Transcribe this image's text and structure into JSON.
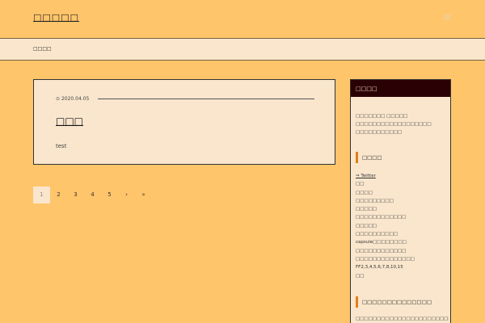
{
  "header": {
    "site_title": "□□□□□",
    "menu_icon": "≡",
    "menu_icon_name": "hamburger-menu-icon"
  },
  "nav": {
    "home": "□□□□"
  },
  "post": {
    "date_icon": "⊙",
    "date": "2020.04.05",
    "title": "□□□",
    "excerpt": "test"
  },
  "pagination": {
    "pages": [
      "1",
      "2",
      "3",
      "4",
      "5"
    ],
    "current": "1",
    "next": "›",
    "last": "»"
  },
  "sidebar": {
    "header": "□□□□",
    "intro": [
      "□□□□□□□ □□□□□",
      "□□□□□□□□□□□□□□□□□□",
      "□□□□□□□□□□□"
    ],
    "widget1_title": "□□□□",
    "links": [
      "⇒ Twitter",
      "□□",
      "□□□□",
      "□□□□□□□□□",
      "□□□□□",
      "□□□□□□□□□□□□",
      "□□□□□",
      "□□□□□□□□□□",
      "capsule□□□□□□□□",
      "□□□□□□□□□□□□",
      "□□□□□□□□□□□□□□",
      "FF2,3,4,5,6,7,8,10,15",
      "□□"
    ],
    "widget2_title": "□□□□□□□□□□□□□□",
    "bottom_text": "□□□□□□□□□□□□□□□□□□□□□□□□□□□"
  },
  "colors": {
    "background": "#ffc56b",
    "panel": "#f9e6cd",
    "sidebar_header": "#2b0004",
    "accent": "#e07f1c"
  }
}
